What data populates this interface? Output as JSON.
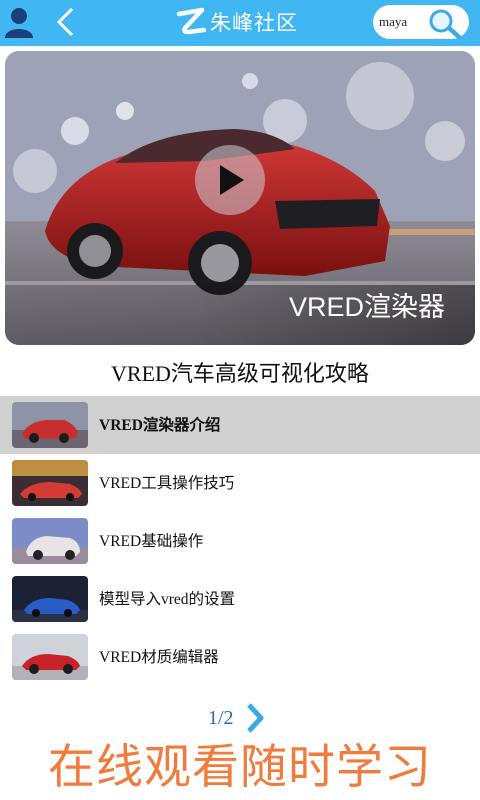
{
  "header": {
    "brand_name": "朱峰社区",
    "search": {
      "value": "maya"
    },
    "accent_color": "#40b7f2"
  },
  "hero": {
    "caption": "VRED渲染器"
  },
  "course": {
    "title": "VRED汽车高级可视化攻略"
  },
  "lessons": [
    {
      "label": "VRED渲染器介绍",
      "active": true
    },
    {
      "label": "VRED工具操作技巧",
      "active": false
    },
    {
      "label": "VRED基础操作",
      "active": false
    },
    {
      "label": "模型导入vred的设置",
      "active": false
    },
    {
      "label": "VRED材质编辑器",
      "active": false
    }
  ],
  "pager": {
    "text": "1/2"
  },
  "slogan": {
    "text": "在线观看随时学习",
    "color": "#f27a3a"
  },
  "icons": [
    "user-icon",
    "back-icon",
    "brand-logo-icon",
    "search-icon",
    "play-icon",
    "chevron-right-icon"
  ]
}
